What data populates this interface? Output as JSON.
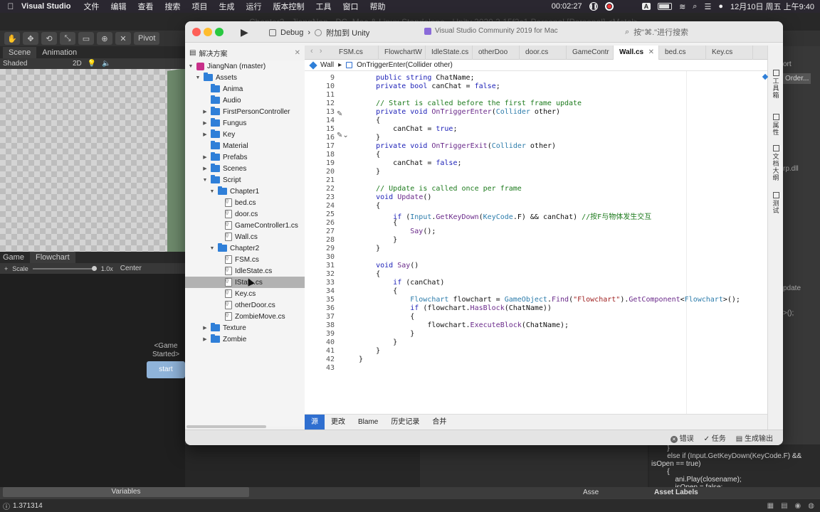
{
  "menubar": {
    "app_name": "Visual Studio",
    "menus": [
      "文件",
      "编辑",
      "查看",
      "搜索",
      "项目",
      "生成",
      "运行",
      "版本控制",
      "工具",
      "窗口",
      "帮助"
    ],
    "timer": "00:02:27",
    "input_method": "A",
    "datetime": "12月10日 周五 上午9:40"
  },
  "unity": {
    "title": "Chapter2 - JiangNan - PC, Mac & Linux Standalone - Unity 2020.3.15f2c1 Personal [Personal] <Metal>",
    "pivot_label": "Pivot",
    "scene_tab": "Scene",
    "animation_tab": "Animation",
    "shading": "Shaded",
    "mode_2d": "2D",
    "game_tab": "Game",
    "flowchart_tab": "Flowchart",
    "scale_label": "Scale",
    "scale_value": "1.0x",
    "center_label": "Center",
    "block_title": "<Game Started>",
    "block_start": "start",
    "variables": "Variables",
    "status_value": "1.371314",
    "inspector_port": "ort",
    "inspector_order": "Order...",
    "inspector_dll": "rp.dll",
    "inspector_update": "pdate",
    "inspector_paren": ">();",
    "code_preview": [
      "        }",
      "        else if (Input.GetKeyDown(KeyCode.F) &&",
      "isOpen == true)",
      "        {",
      "            ani.Play(closename);",
      "            isOpen = false;"
    ],
    "asset_search": "Asse",
    "asset_labels": "Asset Labels"
  },
  "vs": {
    "config": "Debug",
    "target": "附加到 Unity",
    "status": "Visual Studio Community 2019 for Mac",
    "search_placeholder": "按\"⌘.\"进行搜索",
    "solution_panel_title": "解决方案",
    "tree": [
      {
        "label": "JiangNan (master)",
        "kind": "solution",
        "depth": 0,
        "arrow": "▼"
      },
      {
        "label": "Assets",
        "kind": "folder",
        "depth": 1,
        "arrow": "▼"
      },
      {
        "label": "Anima",
        "kind": "folder",
        "depth": 2,
        "arrow": ""
      },
      {
        "label": "Audio",
        "kind": "folder",
        "depth": 2,
        "arrow": ""
      },
      {
        "label": "FirstPersonController",
        "kind": "folder",
        "depth": 2,
        "arrow": "▶"
      },
      {
        "label": "Fungus",
        "kind": "folder",
        "depth": 2,
        "arrow": "▶"
      },
      {
        "label": "Key",
        "kind": "folder",
        "depth": 2,
        "arrow": "▶"
      },
      {
        "label": "Material",
        "kind": "folder",
        "depth": 2,
        "arrow": ""
      },
      {
        "label": "Prefabs",
        "kind": "folder",
        "depth": 2,
        "arrow": "▶"
      },
      {
        "label": "Scenes",
        "kind": "folder",
        "depth": 2,
        "arrow": "▶"
      },
      {
        "label": "Script",
        "kind": "folder",
        "depth": 2,
        "arrow": "▼"
      },
      {
        "label": "Chapter1",
        "kind": "folder",
        "depth": 3,
        "arrow": "▼"
      },
      {
        "label": "bed.cs",
        "kind": "file",
        "depth": 4,
        "arrow": ""
      },
      {
        "label": "door.cs",
        "kind": "file",
        "depth": 4,
        "arrow": ""
      },
      {
        "label": "GameController1.cs",
        "kind": "file",
        "depth": 4,
        "arrow": ""
      },
      {
        "label": "Wall.cs",
        "kind": "file",
        "depth": 4,
        "arrow": ""
      },
      {
        "label": "Chapter2",
        "kind": "folder",
        "depth": 3,
        "arrow": "▼"
      },
      {
        "label": "FSM.cs",
        "kind": "file",
        "depth": 4,
        "arrow": ""
      },
      {
        "label": "IdleState.cs",
        "kind": "file",
        "depth": 4,
        "arrow": ""
      },
      {
        "label": "IStat...cs",
        "kind": "file",
        "depth": 4,
        "arrow": "",
        "selected": true
      },
      {
        "label": "Key.cs",
        "kind": "file",
        "depth": 4,
        "arrow": ""
      },
      {
        "label": "otherDoor.cs",
        "kind": "file",
        "depth": 4,
        "arrow": ""
      },
      {
        "label": "ZombieMove.cs",
        "kind": "file",
        "depth": 4,
        "arrow": ""
      },
      {
        "label": "Texture",
        "kind": "folder",
        "depth": 2,
        "arrow": "▶"
      },
      {
        "label": "Zombie",
        "kind": "folder",
        "depth": 2,
        "arrow": "▶"
      }
    ],
    "tabs": [
      {
        "label": "FSM.cs",
        "active": false
      },
      {
        "label": "FlowchartW",
        "active": false
      },
      {
        "label": "IdleState.cs",
        "active": false
      },
      {
        "label": "otherDoo",
        "active": false
      },
      {
        "label": "door.cs",
        "active": false
      },
      {
        "label": "GameContr",
        "active": false
      },
      {
        "label": "Wall.cs",
        "active": true
      },
      {
        "label": "bed.cs",
        "active": false
      },
      {
        "label": "Key.cs",
        "active": false
      }
    ],
    "breadcrumb_class": "Wall",
    "breadcrumb_method": "OnTriggerEnter(Collider other)",
    "code": [
      {
        "n": "9",
        "html": "    <span class='kw'>public</span> <span class='kw'>string</span> ChatName;"
      },
      {
        "n": "10",
        "html": "    <span class='kw'>private</span> <span class='kw'>bool</span> canChat = <span class='kw'>false</span>;"
      },
      {
        "n": "11",
        "html": ""
      },
      {
        "n": "12",
        "html": "    <span class='cm'>// Start is called before the first frame update</span>"
      },
      {
        "n": "13",
        "html": "    <span class='kw'>private</span> <span class='kw'>void</span> <span class='me'>OnTriggerEnter</span>(<span class='ty'>Collider</span> other)"
      },
      {
        "n": "14",
        "html": "    {"
      },
      {
        "n": "15",
        "html": "        canChat = <span class='kw'>true</span>;"
      },
      {
        "n": "16",
        "html": "    }"
      },
      {
        "n": "17",
        "html": "    <span class='kw'>private</span> <span class='kw'>void</span> <span class='me'>OnTriggerExit</span>(<span class='ty'>Collider</span> other)"
      },
      {
        "n": "18",
        "html": "    {"
      },
      {
        "n": "19",
        "html": "        canChat = <span class='kw'>false</span>;"
      },
      {
        "n": "20",
        "html": "    }"
      },
      {
        "n": "21",
        "html": ""
      },
      {
        "n": "22",
        "html": "    <span class='cm'>// Update is called once per frame</span>"
      },
      {
        "n": "23",
        "html": "    <span class='kw'>void</span> <span class='me'>Update</span>()"
      },
      {
        "n": "24",
        "html": "    {"
      },
      {
        "n": "25",
        "html": "        <span class='kw'>if</span> (<span class='ty'>Input</span>.<span class='me'>GetKeyDown</span>(<span class='ty'>KeyCode</span>.F) &amp;&amp; canChat) <span class='cm'>//按F与物体发生交互</span>"
      },
      {
        "n": "26",
        "html": "        {"
      },
      {
        "n": "27",
        "html": "            <span class='me'>Say</span>();"
      },
      {
        "n": "28",
        "html": "        }"
      },
      {
        "n": "29",
        "html": "    }"
      },
      {
        "n": "30",
        "html": ""
      },
      {
        "n": "31",
        "html": "    <span class='kw'>void</span> <span class='me'>Say</span>()"
      },
      {
        "n": "32",
        "html": "    {"
      },
      {
        "n": "33",
        "html": "        <span class='kw'>if</span> (canChat)"
      },
      {
        "n": "34",
        "html": "        {"
      },
      {
        "n": "35",
        "html": "            <span class='ty'>Flowchart</span> flowchart = <span class='ty'>GameObject</span>.<span class='me'>Find</span>(<span class='st'>\"Flowchart\"</span>).<span class='me'>GetComponent</span>&lt;<span class='ty'>Flowchart</span>&gt;();"
      },
      {
        "n": "36",
        "html": "            <span class='kw'>if</span> (flowchart.<span class='me'>HasBlock</span>(ChatName))"
      },
      {
        "n": "37",
        "html": "            {"
      },
      {
        "n": "38",
        "html": "                flowchart.<span class='me'>ExecuteBlock</span>(ChatName);"
      },
      {
        "n": "39",
        "html": "            }"
      },
      {
        "n": "40",
        "html": "        }"
      },
      {
        "n": "41",
        "html": "    }"
      },
      {
        "n": "42",
        "html": "}"
      },
      {
        "n": "43",
        "html": ""
      }
    ],
    "bottom_tabs": [
      "源",
      "更改",
      "Blame",
      "历史记录",
      "合并"
    ],
    "right_strip": [
      "工具箱",
      "属性",
      "文档大纲",
      "测试"
    ],
    "status_errors": "错误",
    "status_tasks": "任务",
    "status_build": "生成输出"
  }
}
